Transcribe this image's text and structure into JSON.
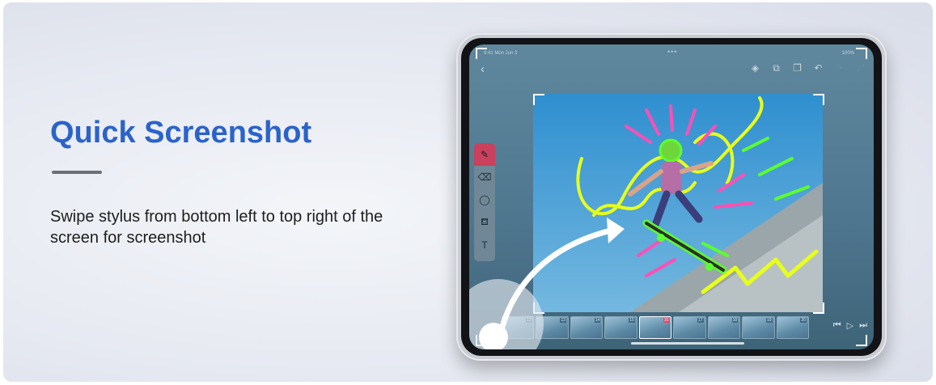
{
  "heading": {
    "title": "Quick Screenshot",
    "description": "Swipe stylus from bottom left to top right of the screen for screenshot"
  },
  "tablet": {
    "status": {
      "time": "9:41 Mon Jun 3",
      "indicators": "100%"
    },
    "toolbar_icons": [
      "layers-icon",
      "import-icon",
      "duplicate-icon",
      "undo-icon",
      "redo-icon",
      "expand-icon"
    ],
    "side_tools": [
      "brush-icon",
      "eraser-icon",
      "lasso-icon",
      "fill-bucket-icon",
      "text-icon"
    ],
    "frames": [
      "12",
      "13",
      "14",
      "15",
      "16",
      "17",
      "18",
      "19",
      "20"
    ],
    "current_frame": "16",
    "playback": [
      "skip-back-icon",
      "play-icon",
      "skip-forward-icon"
    ]
  },
  "colors": {
    "accent": "#2b63c9",
    "neon_yellow": "#e8ff1a",
    "neon_pink": "#ff4fb6",
    "neon_green": "#5bff2e",
    "active_tool": "#c9415c"
  }
}
